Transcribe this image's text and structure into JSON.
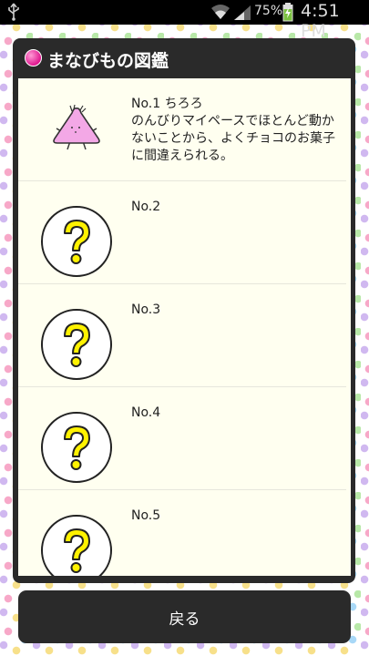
{
  "status_bar": {
    "battery_percent": "75%",
    "time": "4:51 PM"
  },
  "dialog": {
    "title": "まなびもの図鑑",
    "entries": [
      {
        "title": "No.1 ちろろ",
        "description": "のんびりマイペースでほとんど動かないことから、よくチョコのお菓子に間違えられる。",
        "icon": "chiroro-creature-icon"
      },
      {
        "title": "No.2",
        "description": "",
        "icon": "question-mark-icon"
      },
      {
        "title": "No.3",
        "description": "",
        "icon": "question-mark-icon"
      },
      {
        "title": "No.4",
        "description": "",
        "icon": "question-mark-icon"
      },
      {
        "title": "No.5",
        "description": "",
        "icon": "question-mark-icon"
      }
    ]
  },
  "back_button": {
    "label": "戻る"
  },
  "colors": {
    "dialog_bg": "#2a2a2a",
    "list_bg": "#fffff0",
    "question_yellow": "#fff200",
    "creature_pink": "#f0a0e0",
    "title_dot": "#e0188f"
  }
}
